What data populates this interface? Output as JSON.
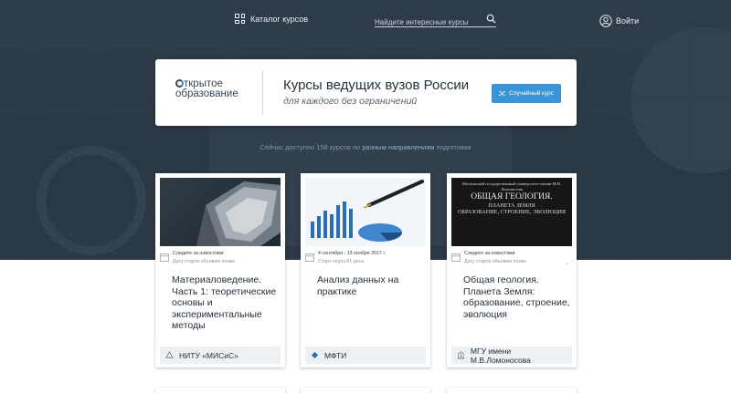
{
  "header": {
    "catalog_label": "Каталог курсов",
    "search_placeholder": "Найдите интересные курсы",
    "login_label": "Войти"
  },
  "banner": {
    "logo_line1": "ткрытое",
    "logo_line2": "образование",
    "title": "Курсы ведущих вузов России",
    "subtitle": "для каждого без ограничений",
    "random_button": "Случайный курс"
  },
  "availability": {
    "prefix": "Сейчас доступно 158 курсов по ",
    "link": "разным направлениям",
    "suffix": " подготовки"
  },
  "courses": [
    {
      "date_line1": "Следите за новостями",
      "date_line2": "Дату старта объявим позже",
      "title": "Материаловедение. Часть 1: теоретические основы и экспериментальные методы",
      "university": "НИТУ «МИСиС»"
    },
    {
      "date_line1": "4 сентября - 13 ноября 2017 г.",
      "date_line2": "Старт через 81 день",
      "title": "Анализ данных на практике",
      "university": "МФТИ"
    },
    {
      "date_line1": "Следите за новостями",
      "date_line2": "Дату старта объявим позже",
      "title": "Общая геология. Планета Земля: образование, строение, эволюция",
      "university": "МГУ имени М.В.Ломоносова",
      "image_text": {
        "header": "Московский государственный университет имени М.В. Ломоносова",
        "headline": "ОБЩАЯ ГЕОЛОГИЯ.",
        "line2": "ПЛАНЕТА ЗЕМЛЯ",
        "line3": "ОБРАЗОВАНИЕ, СТРОЕНИЕ, ЭВОЛЮЦИЯ"
      }
    }
  ],
  "colors": {
    "hero_bg": "#2e3b48",
    "accent": "#3a95d8",
    "link": "#8fb3cd"
  }
}
